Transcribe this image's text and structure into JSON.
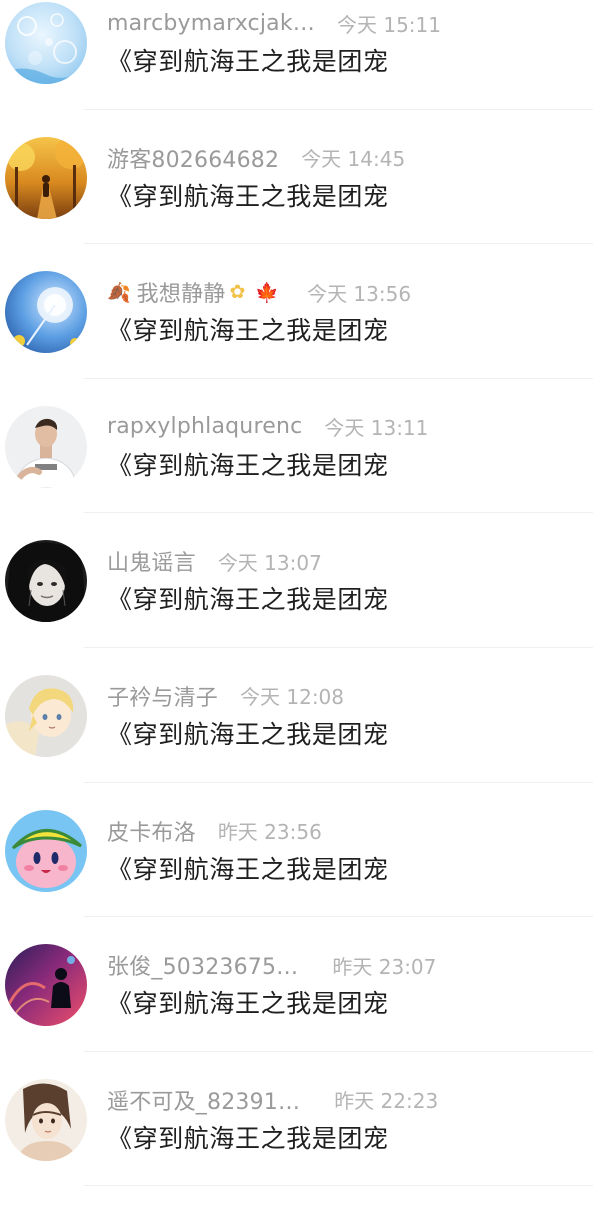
{
  "comments": [
    {
      "name": "marcbymarxcjak…",
      "time": "今天 15:11",
      "text": "《穿到航海王之我是团宠",
      "avatar": "bubbles-avatar"
    },
    {
      "name": "游客802664682",
      "time": "今天 14:45",
      "text": "《穿到航海王之我是团宠",
      "avatar": "autumn-path-avatar"
    },
    {
      "name": "我想静静",
      "time": "今天 13:56",
      "text": "《穿到航海王之我是团宠",
      "avatar": "dandelion-avatar"
    },
    {
      "name": "rapxylphlaqurenc",
      "time": "今天 13:11",
      "text": "《穿到航海王之我是团宠",
      "avatar": "man-portrait-avatar"
    },
    {
      "name": "山鬼谣言",
      "time": "今天 13:07",
      "text": "《穿到航海王之我是团宠",
      "avatar": "dark-manga-avatar"
    },
    {
      "name": "子衿与清子",
      "time": "今天 12:08",
      "text": "《穿到航海王之我是团宠",
      "avatar": "anime-blonde-avatar"
    },
    {
      "name": "皮卡布洛",
      "time": "昨天 23:56",
      "text": "《穿到航海王之我是团宠",
      "avatar": "kirby-avatar"
    },
    {
      "name": "张俊_50323675…",
      "time": "昨天 23:07",
      "text": "《穿到航海王之我是团宠",
      "avatar": "neon-figure-avatar"
    },
    {
      "name": "遥不可及_82391…",
      "time": "昨天 22:23",
      "text": "《穿到航海王之我是团宠",
      "avatar": "sketch-girl-avatar"
    }
  ],
  "decorations": {
    "leaf": "🍂",
    "flower": "✿",
    "maple": "🍁"
  },
  "colors": {
    "name": "#9a9a9a",
    "time": "#b4b4b4",
    "text": "#1f1f1f",
    "divider": "#efefef"
  }
}
